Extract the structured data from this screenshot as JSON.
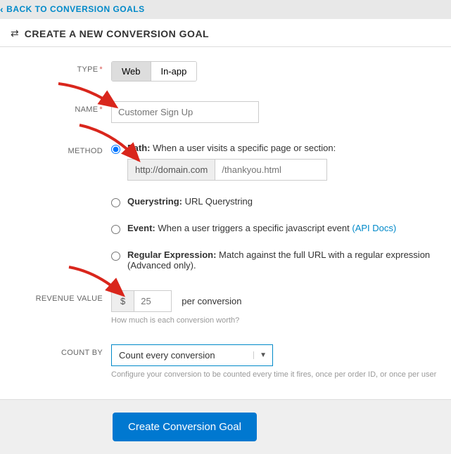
{
  "nav": {
    "back": "Back to Conversion Goals"
  },
  "header": {
    "title": "Create a New Conversion Goal"
  },
  "labels": {
    "type": "TYPE",
    "name": "NAME",
    "method": "METHOD",
    "revenue": "REVENUE VALUE",
    "count_by": "COUNT BY"
  },
  "type": {
    "web": "Web",
    "inapp": "In-app",
    "selected": "web"
  },
  "name": {
    "placeholder": "Customer Sign Up"
  },
  "method": {
    "selected": "path",
    "path": {
      "label_bold": "Path:",
      "label_rest": " When a user visits a specific page or section:",
      "prefix": "http://domain.com",
      "placeholder": "/thankyou.html"
    },
    "querystring": {
      "label_bold": "Querystring:",
      "label_rest": " URL Querystring"
    },
    "event": {
      "label_bold": "Event:",
      "label_rest": " When a user triggers a specific javascript event ",
      "api_link": "(API Docs)"
    },
    "regex": {
      "label_bold": "Regular Expression:",
      "label_rest": " Match against the full URL with a regular expression (Advanced only)."
    }
  },
  "revenue": {
    "currency": "$",
    "placeholder": "25",
    "suffix": "per conversion",
    "hint": "How much is each conversion worth?"
  },
  "count_by": {
    "selected": "Count every conversion",
    "hint": "Configure your conversion to be counted every time it fires, once per order ID, or once per user"
  },
  "submit": {
    "label": "Create Conversion Goal"
  }
}
